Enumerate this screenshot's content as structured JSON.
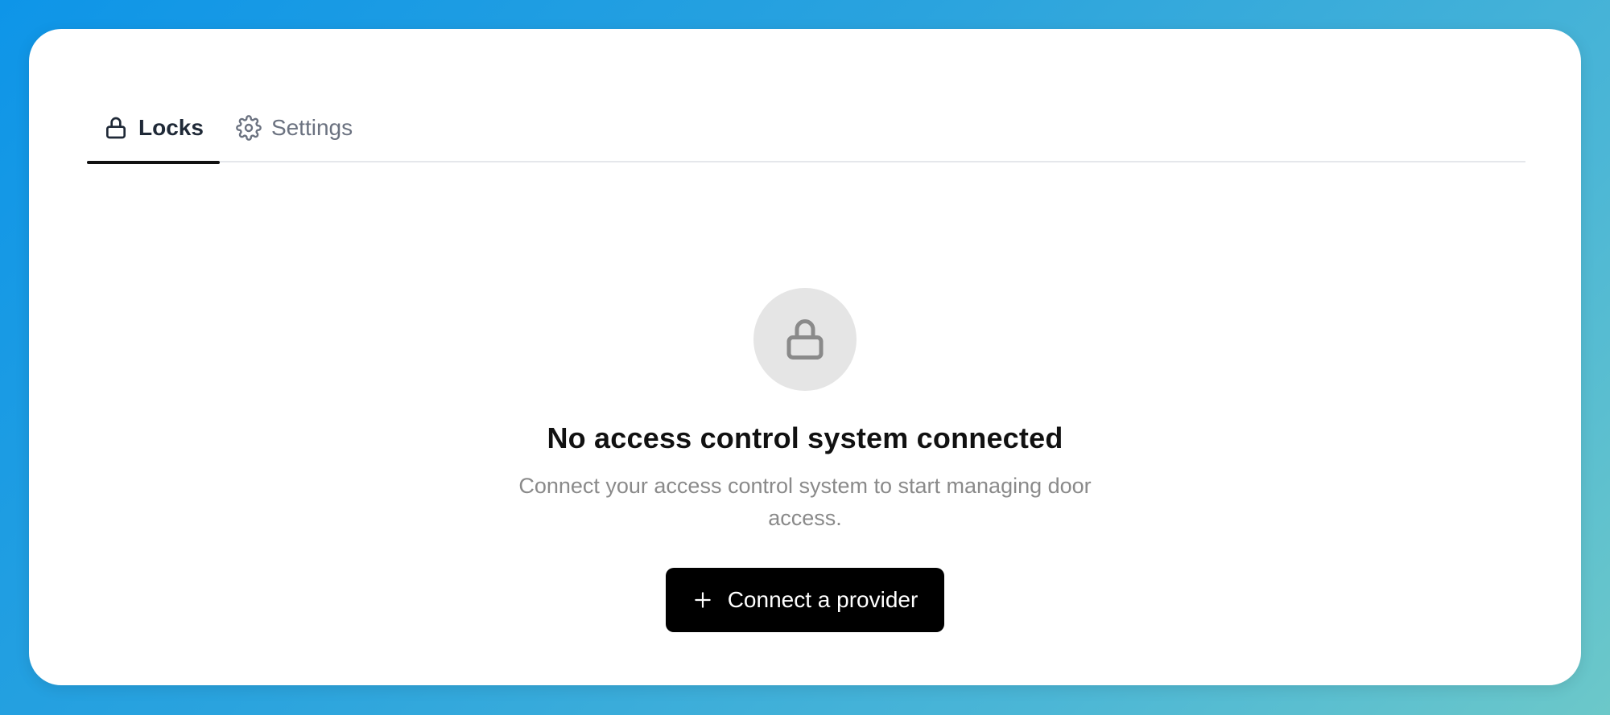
{
  "tabs": [
    {
      "label": "Locks",
      "icon": "lock-icon",
      "active": true
    },
    {
      "label": "Settings",
      "icon": "gear-icon",
      "active": false
    }
  ],
  "empty_state": {
    "icon": "lock-icon",
    "title": "No access control system connected",
    "description": "Connect your access control system to start managing door access.",
    "button_label": "Connect a provider",
    "button_icon": "plus-icon"
  },
  "colors": {
    "active_tab_text": "#1f2937",
    "inactive_tab_text": "#6b7280",
    "button_bg": "#000000",
    "button_text": "#ffffff",
    "icon_circle_bg": "#e5e5e5",
    "icon_stroke": "#8a8a8a"
  }
}
